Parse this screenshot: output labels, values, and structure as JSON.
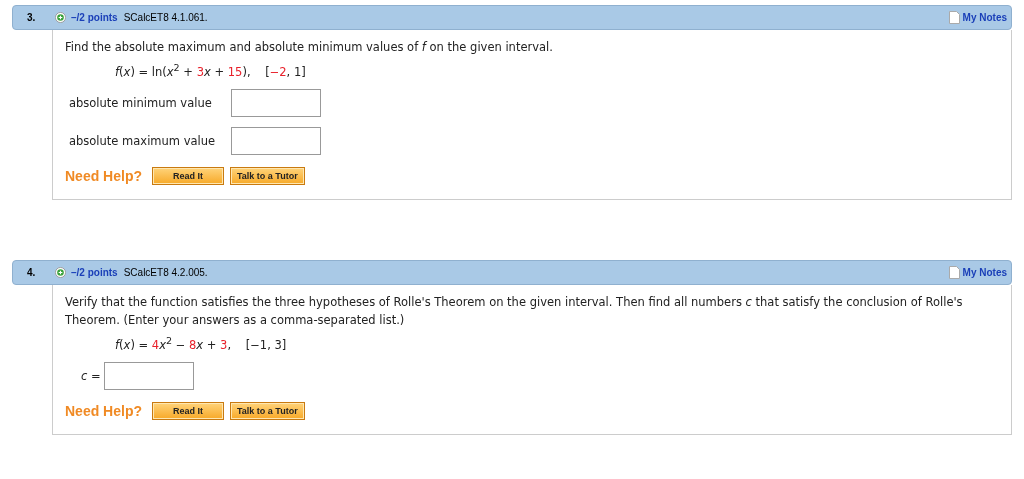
{
  "questions": [
    {
      "number": "3.",
      "points": "–/2 points",
      "code": "SCalcET8 4.1.061.",
      "notes": "My Notes",
      "prompt": "Find the absolute maximum and absolute minimum values of *f* on the given interval.",
      "formula": [
        {
          "text": "*f*(*x*) = ln(*x*$^{2}$ + ",
          "highlight": false
        },
        {
          "text": "3",
          "highlight": true
        },
        {
          "text": "*x* + ",
          "highlight": false
        },
        {
          "text": "15",
          "highlight": true
        },
        {
          "text": "),    [",
          "highlight": false
        },
        {
          "text": "−2",
          "highlight": true
        },
        {
          "text": ", 1]",
          "highlight": false
        }
      ],
      "answers": [
        {
          "label": "absolute minimum value",
          "kind": "wide"
        },
        {
          "label": "absolute maximum value",
          "kind": "wide"
        }
      ],
      "help": "Need Help?",
      "buttons": [
        "Read It",
        "Talk to a Tutor"
      ]
    },
    {
      "number": "4.",
      "points": "–/2 points",
      "code": "SCalcET8 4.2.005.",
      "notes": "My Notes",
      "prompt": "Verify that the function satisfies the three hypotheses of Rolle's Theorem on the given interval. Then find all numbers *c* that satisfy the conclusion of Rolle's Theorem. (Enter your answers as a comma-separated list.)",
      "formula": [
        {
          "text": "*f*(*x*) = ",
          "highlight": false
        },
        {
          "text": "4",
          "highlight": true
        },
        {
          "text": "*x*$^{2}$ − ",
          "highlight": false
        },
        {
          "text": "8",
          "highlight": true
        },
        {
          "text": "*x* + ",
          "highlight": false
        },
        {
          "text": "3",
          "highlight": true
        },
        {
          "text": ",    [−1, 3]",
          "highlight": false
        }
      ],
      "answers": [
        {
          "label": "*c* =",
          "kind": "inline"
        }
      ],
      "help": "Need Help?",
      "buttons": [
        "Read It",
        "Talk to a Tutor"
      ]
    }
  ]
}
